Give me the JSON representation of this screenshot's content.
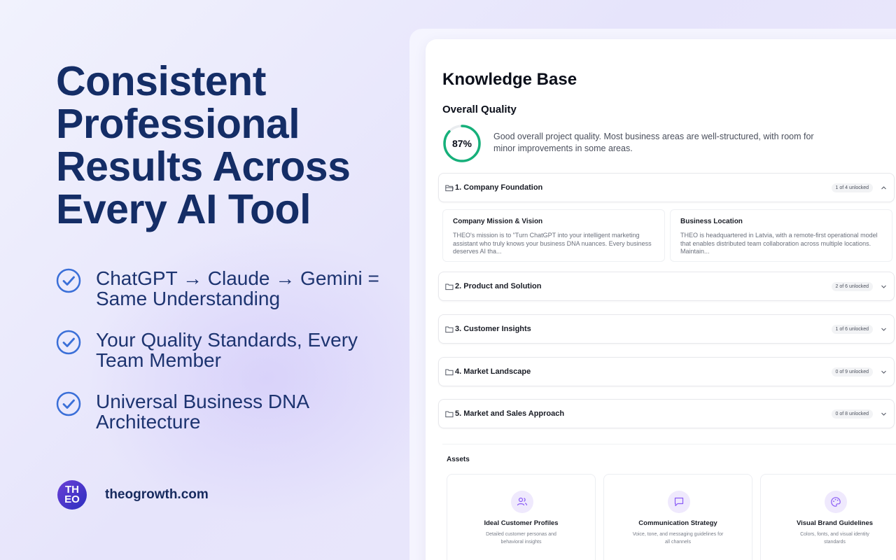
{
  "hero": {
    "title": "Consistent Professional Results Across Every AI Tool"
  },
  "features": [
    {
      "text": "ChatGPT → Claude → Gemini = Same Understanding"
    },
    {
      "text": "Your Quality Standards, Every Team Member"
    },
    {
      "text": "Universal Business DNA Architecture"
    }
  ],
  "brand": {
    "logo_line1": "TH",
    "logo_line2": "EO",
    "url": "theogrowth.com"
  },
  "app": {
    "title": "Knowledge Base",
    "overall_quality": {
      "label": "Overall Quality",
      "percent": 87,
      "percent_text": "87%",
      "description": "Good overall project quality. Most business areas are well-structured, with room for minor improvements in some areas.",
      "ring_color": "#16b07a"
    },
    "sections": [
      {
        "title": "1. Company Foundation",
        "badge": "1 of 4 unlocked",
        "expanded": true
      },
      {
        "title": "2. Product and Solution",
        "badge": "2 of 6 unlocked",
        "expanded": false
      },
      {
        "title": "3. Customer Insights",
        "badge": "1 of 6 unlocked",
        "expanded": false
      },
      {
        "title": "4. Market Landscape",
        "badge": "0 of 9 unlocked",
        "expanded": false
      },
      {
        "title": "5. Market and Sales Approach",
        "badge": "0 of 8 unlocked",
        "expanded": false
      }
    ],
    "foundation_cards": [
      {
        "title": "Company Mission & Vision",
        "body": "THEO's mission is to \"Turn ChatGPT into your intelligent marketing assistant who truly knows your business DNA nuances. Every business deserves AI tha..."
      },
      {
        "title": "Business Location",
        "body": "THEO is headquartered in Latvia, with a remote-first operational model that enables distributed team collaboration across multiple locations. Maintain..."
      }
    ],
    "assets": {
      "label": "Assets",
      "items": [
        {
          "title": "Ideal Customer Profiles",
          "desc": "Detailed customer personas and behavioral insights",
          "icon": "users-icon"
        },
        {
          "title": "Communication Strategy",
          "desc": "Voice, tone, and messaging guidelines for all channels",
          "icon": "chat-icon"
        },
        {
          "title": "Visual Brand Guidelines",
          "desc": "Colors, fonts, and visual identity standards",
          "icon": "palette-icon"
        }
      ]
    }
  },
  "colors": {
    "hero_text": "#142d66",
    "check": "#3a6fd8",
    "accent_purple": "#8b5cf6"
  }
}
